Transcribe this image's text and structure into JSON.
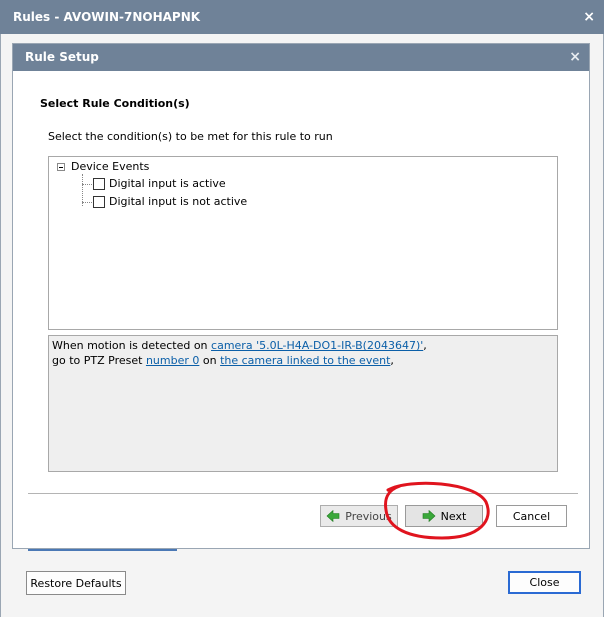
{
  "window": {
    "title": "Rules - AVOWIN-7NOHAPNK",
    "close_glyph": "×"
  },
  "dialog": {
    "title": "Rule Setup",
    "close_glyph": "×",
    "section_heading": "Select Rule Condition(s)",
    "instruction": "Select the condition(s) to be met for this rule to run"
  },
  "tree": {
    "root_label": "Device Events",
    "children": [
      {
        "label": "Digital input is active",
        "checked": false
      },
      {
        "label": "Digital input is not active",
        "checked": false
      }
    ]
  },
  "description": {
    "line1_prefix": "When motion is detected on ",
    "line1_link": "camera '5.0L-H4A-DO1-IR-B(2043647)'",
    "line1_suffix": ",",
    "line2_prefix": "go to PTZ Preset ",
    "line2_link1": "number 0",
    "line2_mid": " on ",
    "line2_link2": "the camera linked to the event",
    "line2_suffix": ","
  },
  "buttons": {
    "previous": "Previous",
    "next": "Next",
    "cancel": "Cancel",
    "restore_defaults": "Restore Defaults",
    "close": "Close"
  },
  "colors": {
    "titlebar": "#6f8298",
    "link": "#0b5fa8",
    "arrow_green": "#3aa83a",
    "annotation_red": "#e0141e"
  },
  "icons": {
    "previous": "arrow-left-icon",
    "next": "arrow-right-icon"
  }
}
